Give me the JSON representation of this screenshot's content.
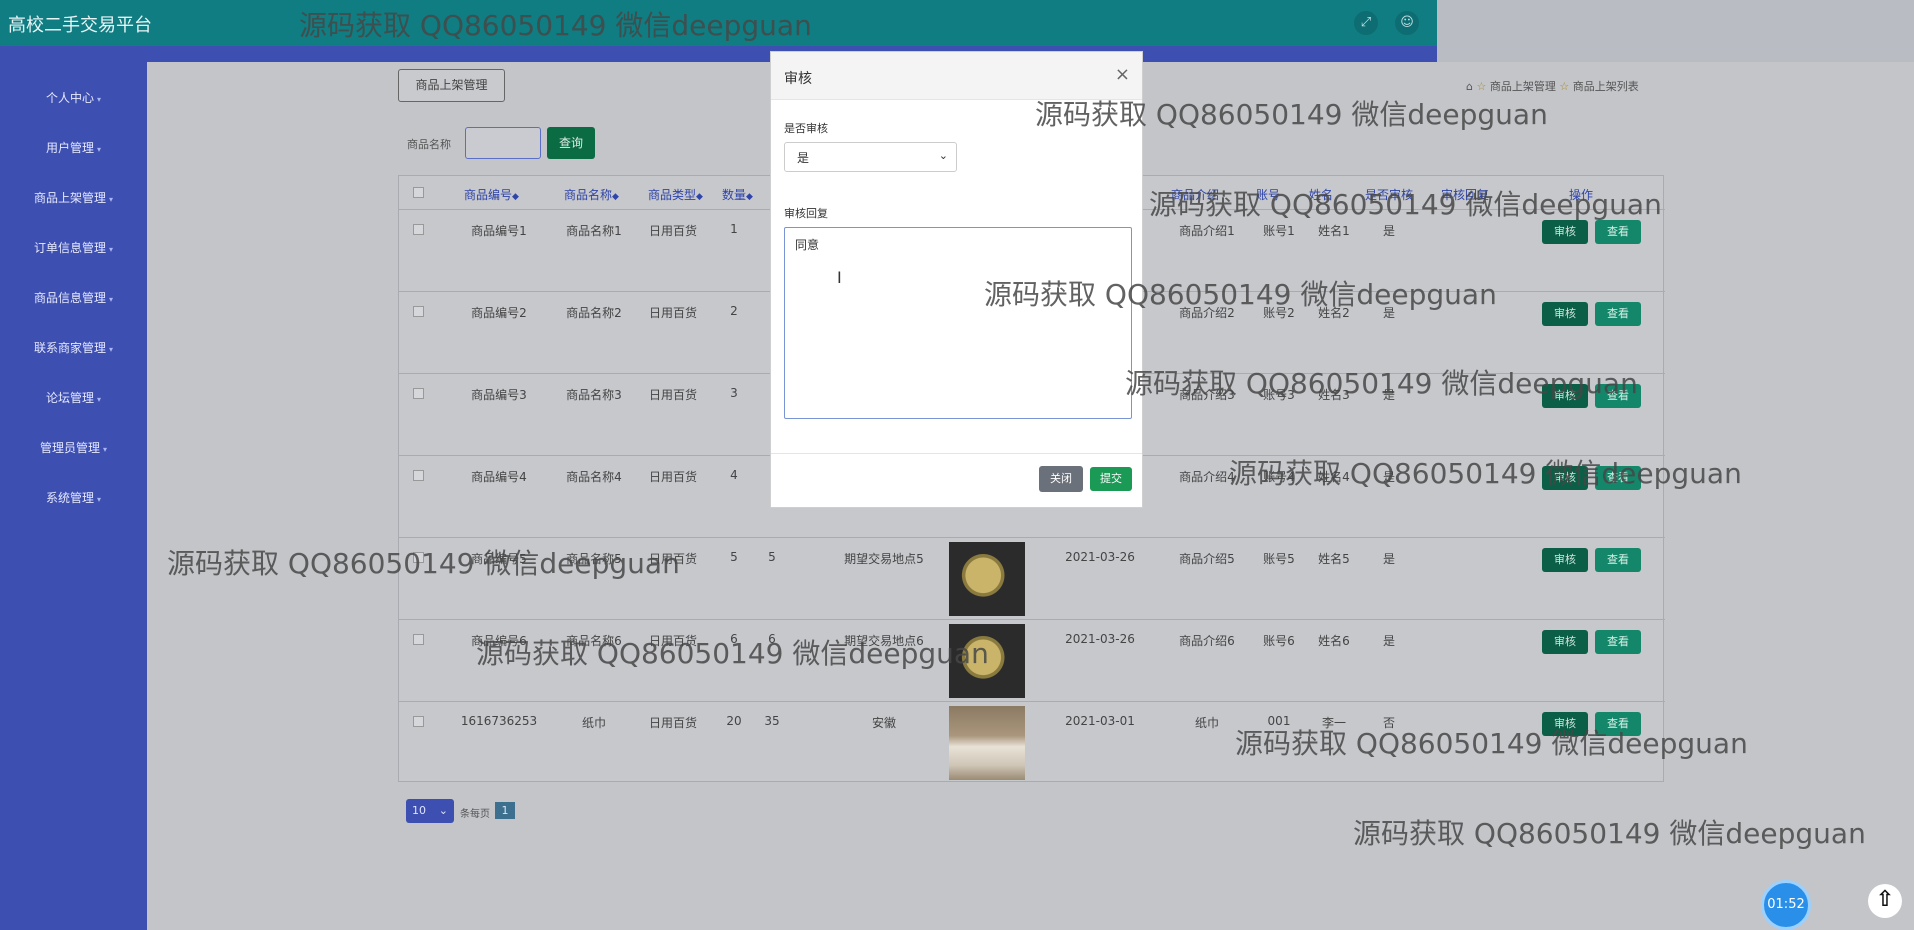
{
  "header": {
    "title": "高校二手交易平台",
    "icons": [
      "expand-icon",
      "user-icon"
    ]
  },
  "sidebar": {
    "items": [
      {
        "label": "个人中心"
      },
      {
        "label": "用户管理"
      },
      {
        "label": "商品上架管理"
      },
      {
        "label": "订单信息管理"
      },
      {
        "label": "商品信息管理"
      },
      {
        "label": "联系商家管理"
      },
      {
        "label": "论坛管理"
      },
      {
        "label": "管理员管理"
      },
      {
        "label": "系统管理"
      }
    ]
  },
  "page": {
    "section_button": "商品上架管理",
    "breadcrumb": {
      "level1": "商品上架管理",
      "level2": "商品上架列表"
    },
    "search": {
      "label": "商品名称",
      "value": "",
      "query_button": "查询"
    }
  },
  "table": {
    "headers": [
      "商品编号",
      "商品名称",
      "商品类型",
      "数量",
      "",
      "",
      "",
      "",
      "商品介绍",
      "账号",
      "姓名",
      "是否审核",
      "审核回复",
      "操作"
    ],
    "rows": [
      {
        "code": "商品编号1",
        "name": "商品名称1",
        "type": "日用百货",
        "qty": "1",
        "price": "",
        "place": "",
        "date": "",
        "intro": "商品介绍1",
        "account": "账号1",
        "person": "姓名1",
        "audited": "是"
      },
      {
        "code": "商品编号2",
        "name": "商品名称2",
        "type": "日用百货",
        "qty": "2",
        "price": "",
        "place": "",
        "date": "",
        "intro": "商品介绍2",
        "account": "账号2",
        "person": "姓名2",
        "audited": "是"
      },
      {
        "code": "商品编号3",
        "name": "商品名称3",
        "type": "日用百货",
        "qty": "3",
        "price": "",
        "place": "",
        "date": "",
        "intro": "商品介绍3",
        "account": "账号3",
        "person": "姓名3",
        "audited": "是"
      },
      {
        "code": "商品编号4",
        "name": "商品名称4",
        "type": "日用百货",
        "qty": "4",
        "price": "",
        "place": "",
        "date": "",
        "intro": "商品介绍4",
        "account": "账号4",
        "person": "姓名4",
        "audited": "是"
      },
      {
        "code": "商品编号5",
        "name": "商品名称5",
        "type": "日用百货",
        "qty": "5",
        "price": "5",
        "place": "期望交易地点5",
        "date": "2021-03-26",
        "intro": "商品介绍5",
        "account": "账号5",
        "person": "姓名5",
        "audited": "是"
      },
      {
        "code": "商品编号6",
        "name": "商品名称6",
        "type": "日用百货",
        "qty": "6",
        "price": "6",
        "place": "期望交易地点6",
        "date": "2021-03-26",
        "intro": "商品介绍6",
        "account": "账号6",
        "person": "姓名6",
        "audited": "是"
      },
      {
        "code": "1616736253",
        "name": "纸巾",
        "type": "日用百货",
        "qty": "20",
        "price": "35",
        "place": "安徽",
        "date": "2021-03-01",
        "intro": "纸巾",
        "account": "001",
        "person": "李一",
        "audited": "否"
      }
    ],
    "audit_button": "审核",
    "view_button": "查看"
  },
  "pagination": {
    "page_size": "10",
    "per_page_label": "条每页",
    "current_page": "1"
  },
  "modal": {
    "title": "审核",
    "close_symbol": "×",
    "audit_label": "是否审核",
    "audit_value": "是",
    "reply_label": "审核回复",
    "reply_value": "同意",
    "close_button": "关闭",
    "submit_button": "提交"
  },
  "watermark_text": "源码获取 QQ86050149 微信deepguan",
  "timer": "01:52",
  "colors": {
    "topbar": "#0f7d82",
    "sidebar": "#3d4fb1",
    "audit": "#0b5f46",
    "view": "#14876a",
    "submit": "#1a9a55"
  }
}
